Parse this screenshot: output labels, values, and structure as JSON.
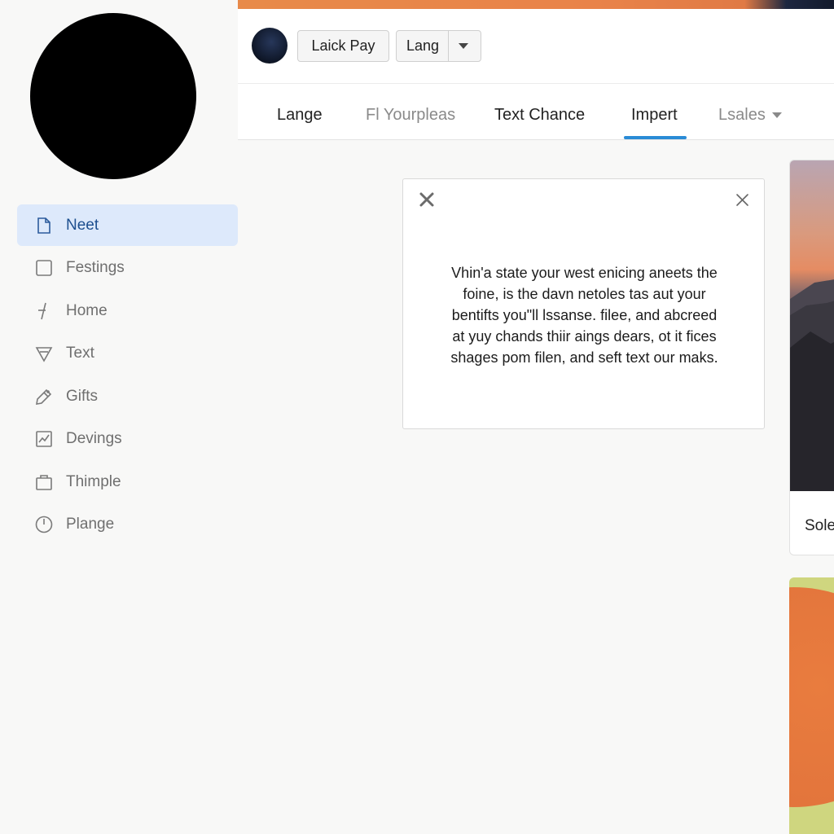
{
  "sidebar": {
    "items": [
      {
        "label": "Neet",
        "icon": "document-icon",
        "active": true
      },
      {
        "label": "Festings",
        "icon": "square-icon",
        "active": false
      },
      {
        "label": "Home",
        "icon": "pen-icon",
        "active": false
      },
      {
        "label": "Text",
        "icon": "funnel-icon",
        "active": false
      },
      {
        "label": "Gifts",
        "icon": "tag-icon",
        "active": false
      },
      {
        "label": "Devings",
        "icon": "chart-icon",
        "active": false
      },
      {
        "label": "Thimple",
        "icon": "bag-icon",
        "active": false
      },
      {
        "label": "Plange",
        "icon": "clock-icon",
        "active": false
      }
    ]
  },
  "toolbar": {
    "pay_label": "Laick Pay",
    "lang_label": "Lang"
  },
  "tabs": [
    {
      "label": "Lange"
    },
    {
      "label": "Fl Yourpleas"
    },
    {
      "label": "Text Chance"
    },
    {
      "label": "Impert",
      "active": true
    },
    {
      "label": "Lsales"
    }
  ],
  "dialog": {
    "lines": [
      "Vhin'a state your west enicing aneets the",
      "foine, is the davn netoles tas aut your",
      "bentifts you\"ll lssanse. filee, and abcreed",
      "at yuy chands thiir aings dears, ot it fices",
      "shages pom filen, and seft text our maks."
    ]
  },
  "cards": {
    "first_label": "Sole"
  },
  "colors": {
    "accent": "#2a8bd6",
    "active_nav_bg": "#dde9fb",
    "active_nav_text": "#1d4f8f"
  }
}
